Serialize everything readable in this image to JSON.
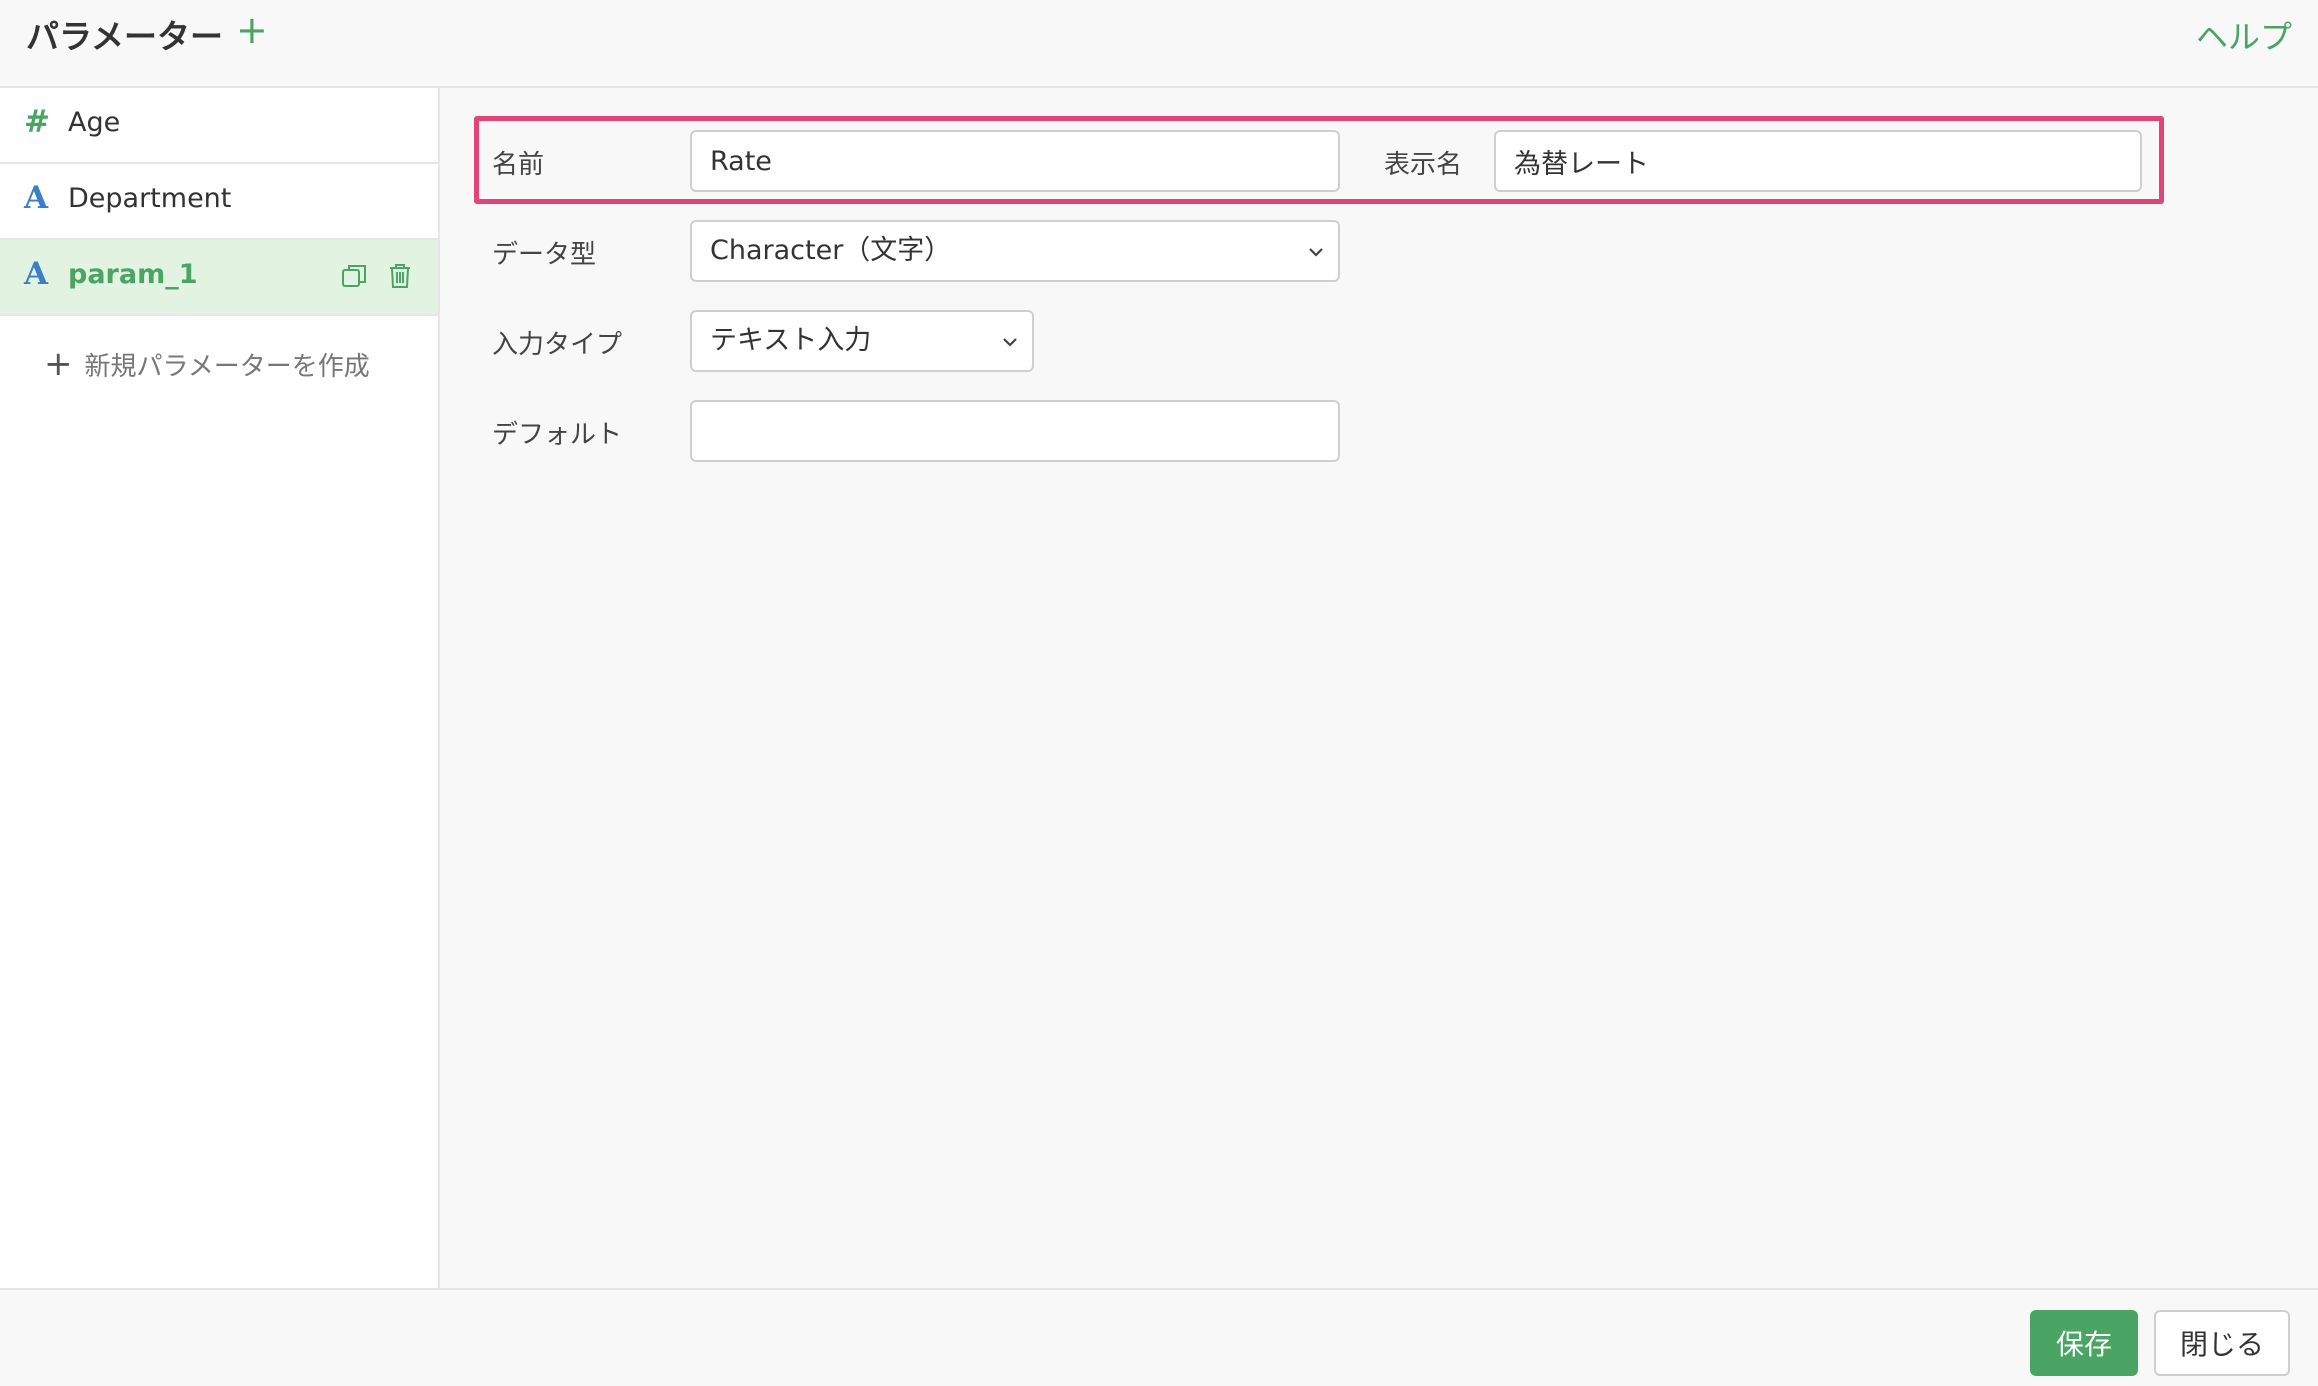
{
  "header": {
    "title": "パラメーター",
    "add_symbol": "+",
    "help_label": "ヘルプ"
  },
  "sidebar": {
    "items": [
      {
        "type_symbol": "#",
        "type": "number",
        "label": "Age",
        "active": false
      },
      {
        "type_symbol": "A",
        "type": "character",
        "label": "Department",
        "active": false
      },
      {
        "type_symbol": "A",
        "type": "character",
        "label": "param_1",
        "active": true
      }
    ],
    "new_param_label": "新規パラメーターを作成",
    "new_param_symbol": "+"
  },
  "form": {
    "name_label": "名前",
    "name_value": "Rate",
    "display_name_label": "表示名",
    "display_name_value": "為替レート",
    "data_type_label": "データ型",
    "data_type_value": "Character（文字）",
    "input_type_label": "入力タイプ",
    "input_type_value": "テキスト入力",
    "default_label": "デフォルト",
    "default_value": ""
  },
  "footer": {
    "save_label": "保存",
    "close_label": "閉じる"
  },
  "colors": {
    "accent": "#4aa564",
    "highlight": "#e0447a",
    "char_type": "#3b7fc6"
  }
}
